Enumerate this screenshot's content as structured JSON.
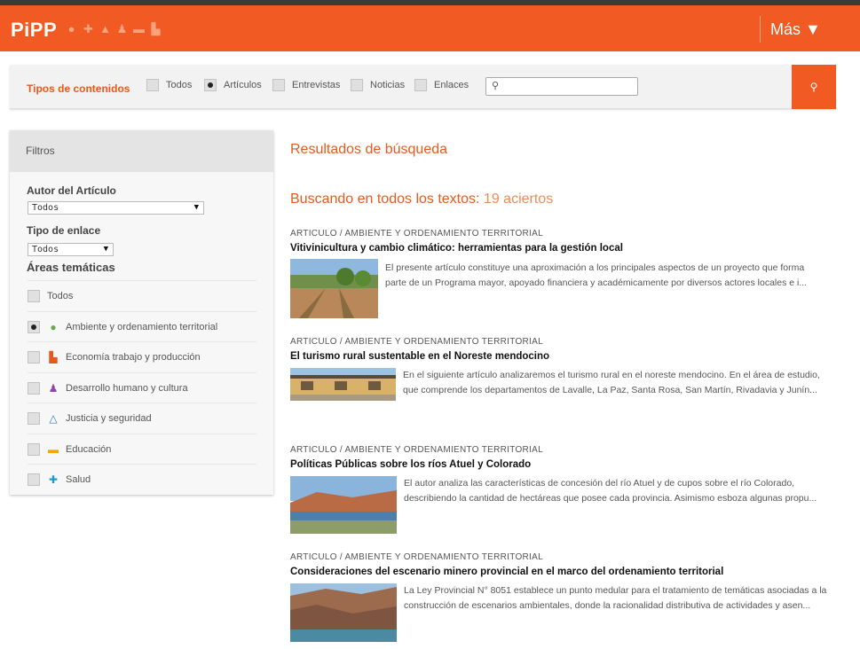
{
  "header": {
    "logo": "PiPP",
    "icons": [
      "drop-icon",
      "cross-icon",
      "triangle-icon",
      "person-icon",
      "book-icon",
      "factory-icon"
    ],
    "more_label": "Más ▼"
  },
  "searchbar": {
    "label": "Tipos de contenidos",
    "options": [
      {
        "label": "Todos",
        "checked": false
      },
      {
        "label": "Artículos",
        "checked": true
      },
      {
        "label": "Entrevistas",
        "checked": false
      },
      {
        "label": "Noticias",
        "checked": false
      },
      {
        "label": "Enlaces",
        "checked": false
      }
    ],
    "input_value": "",
    "input_placeholder": ""
  },
  "filters": {
    "title": "Filtros",
    "autor_label": "Autor del Artículo",
    "autor_value": "Todos",
    "tipo_label": "Tipo de enlace",
    "tipo_value": "Todos",
    "areas_label": "Áreas temáticas",
    "areas": [
      {
        "label": "Todos",
        "checked": false,
        "icon": "",
        "color": ""
      },
      {
        "label": "Ambiente y ordenamiento territorial",
        "checked": true,
        "icon": "drop-icon",
        "color": "#6aa84f"
      },
      {
        "label": "Economía trabajo y producción",
        "checked": false,
        "icon": "factory-icon",
        "color": "#e8591f"
      },
      {
        "label": "Desarrollo humano y cultura",
        "checked": false,
        "icon": "person-icon",
        "color": "#8e44ad"
      },
      {
        "label": "Justicia y seguridad",
        "checked": false,
        "icon": "triangle-icon",
        "color": "#2a7ac0"
      },
      {
        "label": "Educación",
        "checked": false,
        "icon": "book-icon",
        "color": "#f0a500"
      },
      {
        "label": "Salud",
        "checked": false,
        "icon": "cross-icon",
        "color": "#1a9bd7"
      }
    ]
  },
  "results": {
    "title": "Resultados de búsqueda",
    "count_prefix": "Buscando en todos los textos:",
    "count_value": "19 aciertos",
    "items": [
      {
        "category": "ARTICULO / AMBIENTE Y ORDENAMIENTO TERRITORIAL",
        "title": "Vitivinicultura y cambio climático: herramientas para la gestión local",
        "line1": "El presente artículo constituye una aproximación a los principales aspectos de un proyecto que forma",
        "line2": "parte de un Programa mayor, apoyado financiera y académicamente por diversos actores locales e i...",
        "image": "vineyard-image"
      },
      {
        "category": "ARTICULO / AMBIENTE Y ORDENAMIENTO TERRITORIAL",
        "title": "El turismo rural sustentable en el Noreste mendocino",
        "line1": "En el siguiente artículo analizaremos el turismo rural en el noreste mendocino. En el área de estudio,",
        "line2": "que comprende los departamentos de Lavalle, La Paz, Santa Rosa, San Martín, Rivadavia y Junín...",
        "image": "building-image"
      },
      {
        "category": "ARTICULO / AMBIENTE Y ORDENAMIENTO TERRITORIAL",
        "title": "Políticas Públicas sobre los ríos Atuel y Colorado",
        "line1": "El autor analiza las características de concesión del río Atuel y de cupos sobre el río Colorado,",
        "line2": "describiendo la cantidad de hectáreas que posee cada provincia.  Asimismo esboza algunas propu...",
        "image": "river-image"
      },
      {
        "category": "ARTICULO / AMBIENTE Y ORDENAMIENTO TERRITORIAL",
        "title": "Consideraciones del escenario minero provincial en el marco del ordenamiento territorial",
        "line1": "La Ley Provincial N° 8051 establece un punto medular para el tratamiento de temáticas asociadas a la",
        "line2": "construcción de escenarios ambientales, donde la racionalidad distributiva de actividades y asen...",
        "image": "canyon-image"
      }
    ]
  },
  "colors": {
    "accent": "#f15a22",
    "accent_text": "#e8591f"
  }
}
